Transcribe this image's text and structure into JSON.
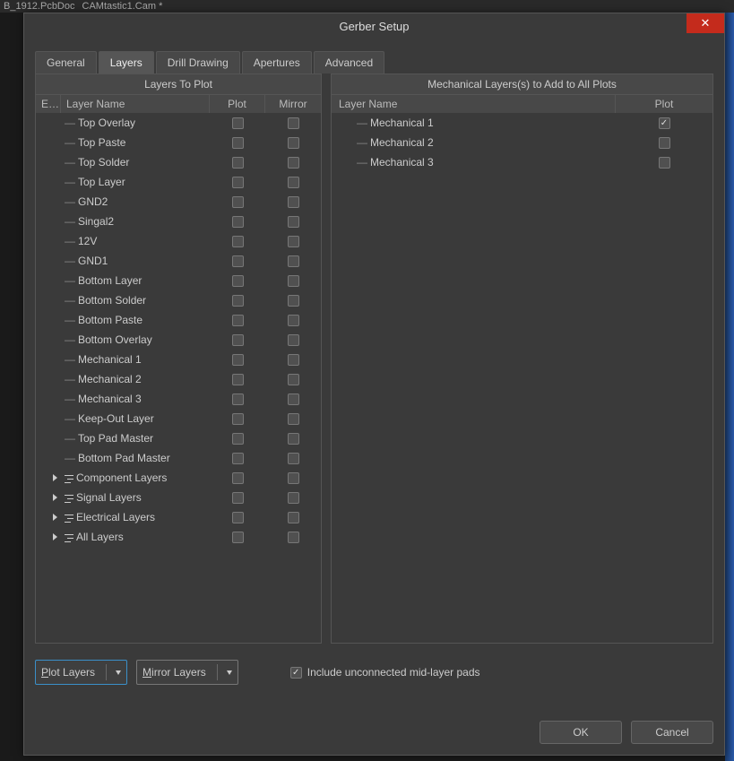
{
  "app": {
    "bgTabs": [
      "B_1912.PcbDoc",
      "CAMtastic1.Cam *"
    ]
  },
  "dialog": {
    "title": "Gerber Setup",
    "closeGlyph": "✕"
  },
  "tabs": {
    "items": [
      {
        "label": "General",
        "active": false
      },
      {
        "label": "Layers",
        "active": true
      },
      {
        "label": "Drill Drawing",
        "active": false
      },
      {
        "label": "Apertures",
        "active": false
      },
      {
        "label": "Advanced",
        "active": false
      }
    ]
  },
  "leftPanel": {
    "title": "Layers To Plot",
    "headers": {
      "ext": "Ex...",
      "name": "Layer Name",
      "plot": "Plot",
      "mirror": "Mirror"
    },
    "rows": [
      {
        "name": "Top Overlay",
        "kind": "leaf",
        "plot": false,
        "mirror": false
      },
      {
        "name": "Top Paste",
        "kind": "leaf",
        "plot": false,
        "mirror": false
      },
      {
        "name": "Top Solder",
        "kind": "leaf",
        "plot": false,
        "mirror": false
      },
      {
        "name": "Top Layer",
        "kind": "leaf",
        "plot": false,
        "mirror": false
      },
      {
        "name": "GND2",
        "kind": "leaf",
        "plot": false,
        "mirror": false
      },
      {
        "name": "Singal2",
        "kind": "leaf",
        "plot": false,
        "mirror": false
      },
      {
        "name": "12V",
        "kind": "leaf",
        "plot": false,
        "mirror": false
      },
      {
        "name": "GND1",
        "kind": "leaf",
        "plot": false,
        "mirror": false
      },
      {
        "name": "Bottom Layer",
        "kind": "leaf",
        "plot": false,
        "mirror": false
      },
      {
        "name": "Bottom Solder",
        "kind": "leaf",
        "plot": false,
        "mirror": false
      },
      {
        "name": "Bottom Paste",
        "kind": "leaf",
        "plot": false,
        "mirror": false
      },
      {
        "name": "Bottom Overlay",
        "kind": "leaf",
        "plot": false,
        "mirror": false
      },
      {
        "name": "Mechanical 1",
        "kind": "leaf",
        "plot": false,
        "mirror": false
      },
      {
        "name": "Mechanical 2",
        "kind": "leaf",
        "plot": false,
        "mirror": false
      },
      {
        "name": "Mechanical 3",
        "kind": "leaf",
        "plot": false,
        "mirror": false
      },
      {
        "name": "Keep-Out Layer",
        "kind": "leaf",
        "plot": false,
        "mirror": false
      },
      {
        "name": "Top Pad Master",
        "kind": "leaf",
        "plot": false,
        "mirror": false
      },
      {
        "name": "Bottom Pad Master",
        "kind": "leaf",
        "plot": false,
        "mirror": false
      },
      {
        "name": "Component Layers",
        "kind": "category",
        "plot": false,
        "mirror": false
      },
      {
        "name": "Signal Layers",
        "kind": "category",
        "plot": false,
        "mirror": false
      },
      {
        "name": "Electrical Layers",
        "kind": "category",
        "plot": false,
        "mirror": false
      },
      {
        "name": "All Layers",
        "kind": "category",
        "plot": false,
        "mirror": false
      }
    ]
  },
  "rightPanel": {
    "title": "Mechanical Layers(s) to Add to All Plots",
    "headers": {
      "name": "Layer Name",
      "plot": "Plot"
    },
    "rows": [
      {
        "name": "Mechanical 1",
        "plot": true
      },
      {
        "name": "Mechanical 2",
        "plot": false
      },
      {
        "name": "Mechanical 3",
        "plot": false
      }
    ]
  },
  "buttons": {
    "plotLayers": "Plot Layers",
    "mirrorLayers": "Mirror Layers",
    "includeMidLayerPads": "Include unconnected mid-layer pads",
    "includeMidLayerPadsChecked": true,
    "ok": "OK",
    "cancel": "Cancel"
  }
}
